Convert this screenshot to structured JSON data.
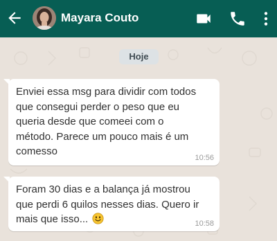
{
  "header": {
    "contact_name": "Mayara Couto",
    "back_icon": "back-arrow-icon",
    "video_icon": "video-call-icon",
    "call_icon": "phone-icon",
    "menu_icon": "kebab-menu-icon",
    "color": "#075e54"
  },
  "chat": {
    "date_label": "Hoje",
    "messages": [
      {
        "text_lines": [
          "Enviei essa msg para dividir com todos",
          "que consegui perder o peso que eu",
          "queria desde que comeei com o",
          "método. Parece um pouco mais é um",
          "comesso"
        ],
        "time": "10:56"
      },
      {
        "text_lines": [
          "Foram 30 dias e a balança já mostrou",
          "que perdi 6 quilos nesses dias. Quero ir",
          "mais que isso..."
        ],
        "emoji": "smiling-face-emoji",
        "time": "10:58"
      }
    ]
  },
  "colors": {
    "chat_background": "#e9e2db",
    "bubble": "#ffffff",
    "date_chip": "#dde2e5"
  }
}
